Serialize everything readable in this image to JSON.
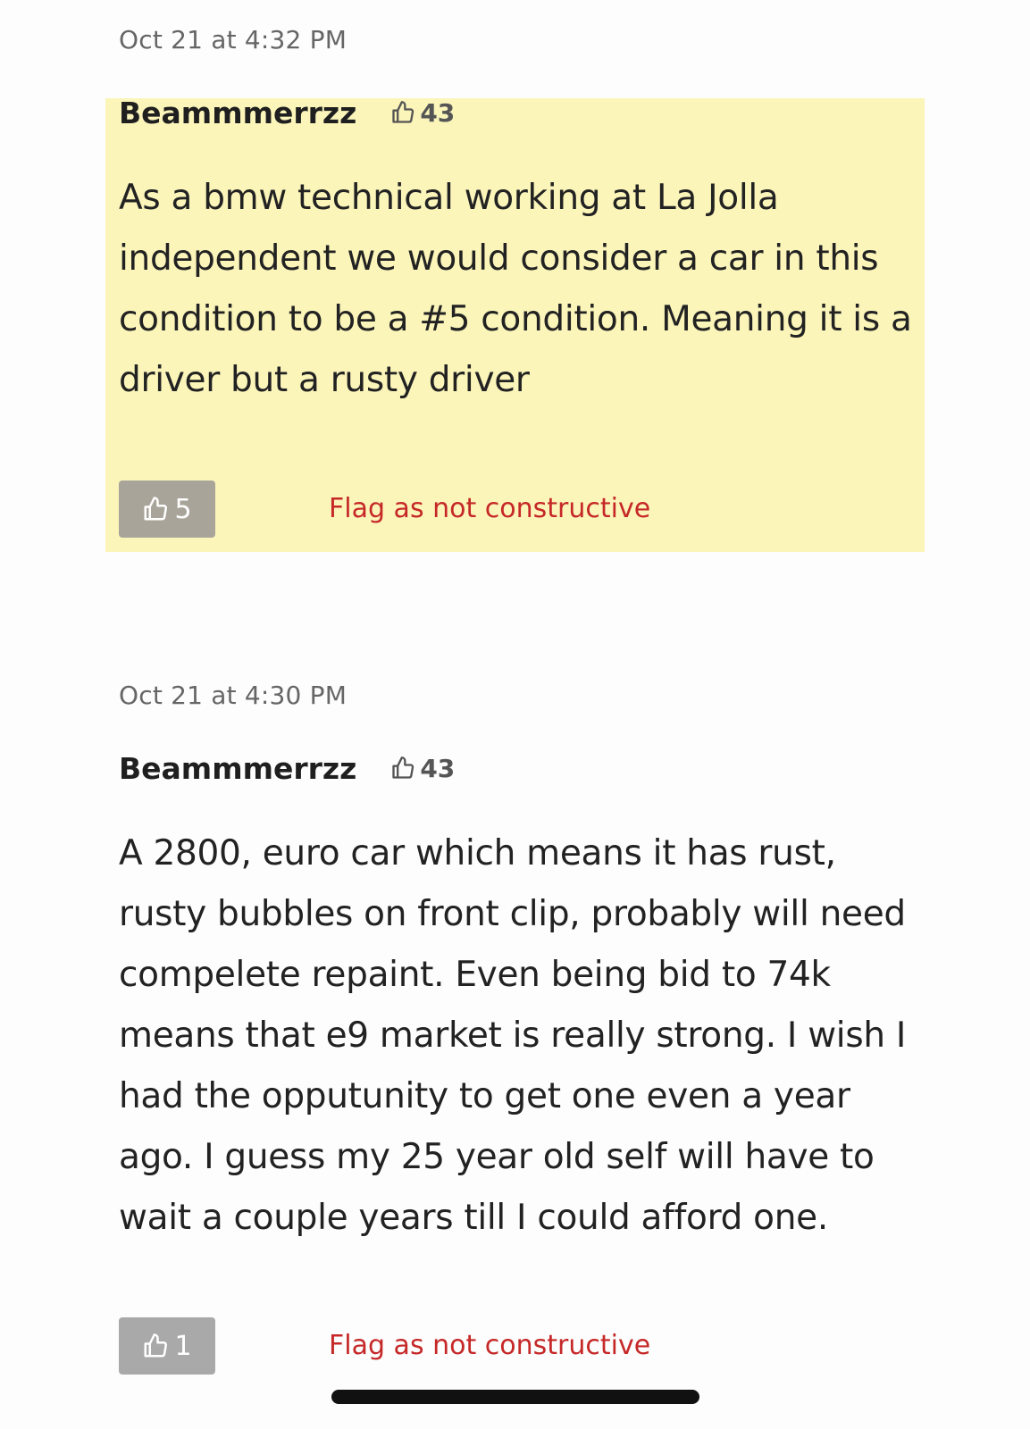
{
  "comments": [
    {
      "timestamp": "Oct 21 at 4:32 PM",
      "username": "Beammmerrzz",
      "reputation": "43",
      "body": "As a bmw technical working at La Jolla independent we would consider a car in this condition to be a #5 condition. Meaning it is a driver but a rusty driver",
      "likes": "5",
      "flag_label": "Flag as not constructive",
      "highlighted": true
    },
    {
      "timestamp": "Oct 21 at 4:30 PM",
      "username": "Beammmerrzz",
      "reputation": "43",
      "body": "A 2800, euro car which means it has rust, rusty bubbles on front clip, probably will need compelete repaint. Even being bid to 74k means that e9 market is really strong. I wish I had the opputunity to get one even a year ago. I guess my 25 year old self will have to wait a couple years till I could afford one.",
      "likes": "1",
      "flag_label": "Flag as not constructive",
      "highlighted": false
    }
  ],
  "colors": {
    "highlight_background": "#fbf5ba",
    "flag_link": "#c62828",
    "like_button_highlighted": "#a8a49a",
    "like_button_default": "#a9a9a9"
  },
  "icons": {
    "reputation": "thumbs-up-icon",
    "like": "thumbs-up-icon"
  }
}
